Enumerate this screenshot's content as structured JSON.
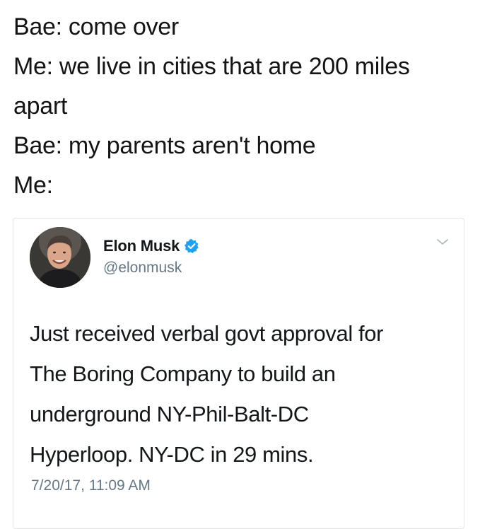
{
  "meme": {
    "lines": [
      "Bae: come over",
      "Me: we live in cities that are 200 miles",
      "apart",
      "Bae: my parents aren't home",
      "Me:"
    ]
  },
  "tweet": {
    "author_name": "Elon Musk",
    "author_handle": "@elonmusk",
    "verified": true,
    "body_lines": [
      "Just received verbal govt approval for",
      "The Boring Company to build an",
      "underground NY-Phil-Balt-DC",
      "Hyperloop. NY-DC in 29 mins."
    ],
    "timestamp": "7/20/17, 11:09 AM",
    "icons": {
      "verified": "verified-badge-icon",
      "menu": "chevron-down-icon"
    },
    "colors": {
      "verified_blue": "#1da1f2",
      "text": "#14171a",
      "muted": "#657786",
      "border": "#e3e6e8"
    }
  }
}
